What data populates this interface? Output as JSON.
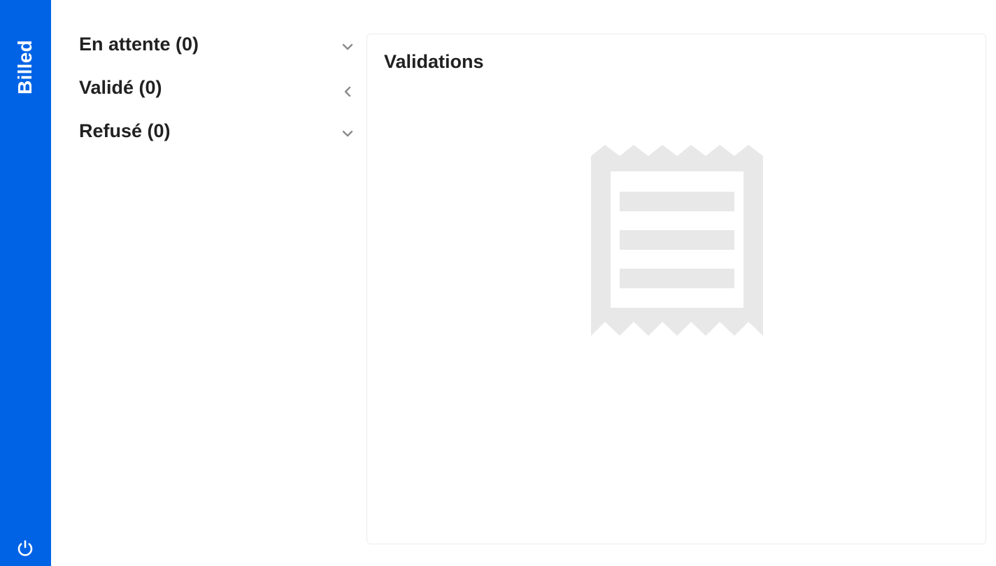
{
  "app": {
    "brand": "Billed"
  },
  "sidebar": {
    "logout_icon": "power-icon",
    "colors": {
      "background": "#0063e6",
      "foreground": "#ffffff"
    }
  },
  "statuses": [
    {
      "label": "En attente (0)",
      "icon": "chevron-down-icon"
    },
    {
      "label": "Validé (0)",
      "icon": "chevron-left-icon"
    },
    {
      "label": "Refusé (0)",
      "icon": "chevron-down-icon"
    }
  ],
  "panel": {
    "title": "Validations",
    "placeholder_icon": "receipt-icon"
  },
  "colors": {
    "accent": "#0063e6",
    "placeholder": "#e8e8e8",
    "chevron": "#8a8a8a"
  }
}
